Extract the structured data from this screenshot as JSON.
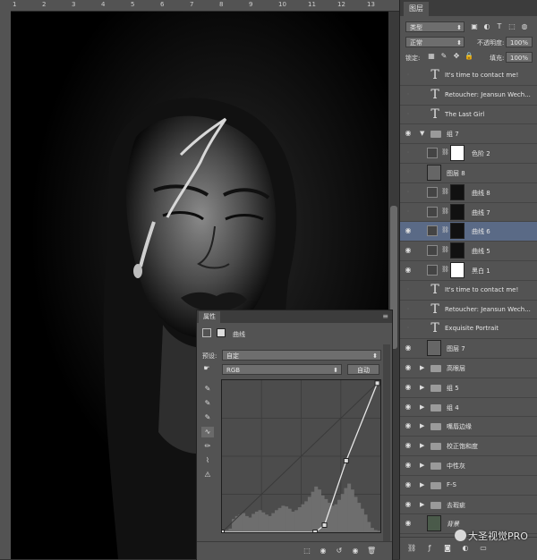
{
  "layers_panel": {
    "tab_label": "图层",
    "filter_kind": "类型",
    "blend_mode": "正常",
    "opacity_label": "不透明度:",
    "opacity_value": "100%",
    "lock_label": "锁定:",
    "fill_label": "填充:",
    "fill_value": "100%",
    "layers": [
      {
        "name": "It's time to contact me!",
        "kind": "text",
        "visible": false
      },
      {
        "name": "Retoucher: Jeansun Wech...",
        "kind": "text",
        "visible": false
      },
      {
        "name": "The Last Girl",
        "kind": "text",
        "visible": false
      },
      {
        "name": "组 7",
        "kind": "group-open",
        "visible": true
      },
      {
        "name": "色阶 2",
        "kind": "adjustment",
        "visible": false
      },
      {
        "name": "图层 8",
        "kind": "pixel",
        "visible": false
      },
      {
        "name": "曲线 8",
        "kind": "curves",
        "visible": false
      },
      {
        "name": "曲线 7",
        "kind": "curves",
        "visible": false
      },
      {
        "name": "曲线 6",
        "kind": "curves",
        "visible": true,
        "selected": true
      },
      {
        "name": "曲线 5",
        "kind": "curves",
        "visible": true
      },
      {
        "name": "黑白 1",
        "kind": "adjustment",
        "visible": true
      },
      {
        "name": "It's time to contact me!",
        "kind": "text",
        "visible": false
      },
      {
        "name": "Retoucher: Jeansun Wech...",
        "kind": "text",
        "visible": false
      },
      {
        "name": "Exquisite Portrait",
        "kind": "text",
        "visible": false
      },
      {
        "name": "图层 7",
        "kind": "pixel",
        "visible": true
      },
      {
        "name": "高眼层",
        "kind": "group",
        "visible": true
      },
      {
        "name": "组 5",
        "kind": "group",
        "visible": true
      },
      {
        "name": "组 4",
        "kind": "group",
        "visible": true
      },
      {
        "name": "嘴唇边缘",
        "kind": "group",
        "visible": true
      },
      {
        "name": "校正饱和度",
        "kind": "group",
        "visible": true
      },
      {
        "name": "中性灰",
        "kind": "group",
        "visible": true
      },
      {
        "name": "F-S",
        "kind": "group",
        "visible": true
      },
      {
        "name": "去瑕疵",
        "kind": "group",
        "visible": true
      },
      {
        "name": "背景",
        "kind": "background",
        "visible": true
      }
    ]
  },
  "properties": {
    "tab_label": "属性",
    "adjustment_name": "曲线",
    "preset_label": "预设:",
    "preset_value": "自定",
    "channel_value": "RGB",
    "auto_button": "自动"
  },
  "watermark": "大圣视觉PRO",
  "ruler_numbers": [
    "1",
    "2",
    "3",
    "4",
    "5",
    "6",
    "7",
    "8",
    "9",
    "10",
    "11",
    "12",
    "13"
  ],
  "icons": {
    "visibility": "eye-icon",
    "link": "chain-icon",
    "curves_tool": "curve-icon",
    "eyedropper": "eyedropper-icon",
    "pencil": "pencil-icon",
    "smooth": "smooth-icon",
    "warning": "warning-icon"
  },
  "chart_data": {
    "type": "curve",
    "channel": "RGB",
    "xlim": [
      0,
      255
    ],
    "ylim": [
      0,
      255
    ],
    "curve_points": [
      [
        0,
        0
      ],
      [
        150,
        0
      ],
      [
        165,
        12
      ],
      [
        200,
        120
      ],
      [
        250,
        250
      ]
    ],
    "histogram": [
      2,
      3,
      5,
      18,
      22,
      24,
      26,
      22,
      20,
      25,
      28,
      30,
      27,
      24,
      22,
      26,
      30,
      33,
      36,
      35,
      32,
      28,
      30,
      34,
      38,
      42,
      48,
      55,
      62,
      58,
      50,
      45,
      40,
      36,
      38,
      44,
      52,
      60,
      66,
      58,
      48,
      40,
      32,
      24,
      14,
      6,
      3,
      2
    ]
  }
}
